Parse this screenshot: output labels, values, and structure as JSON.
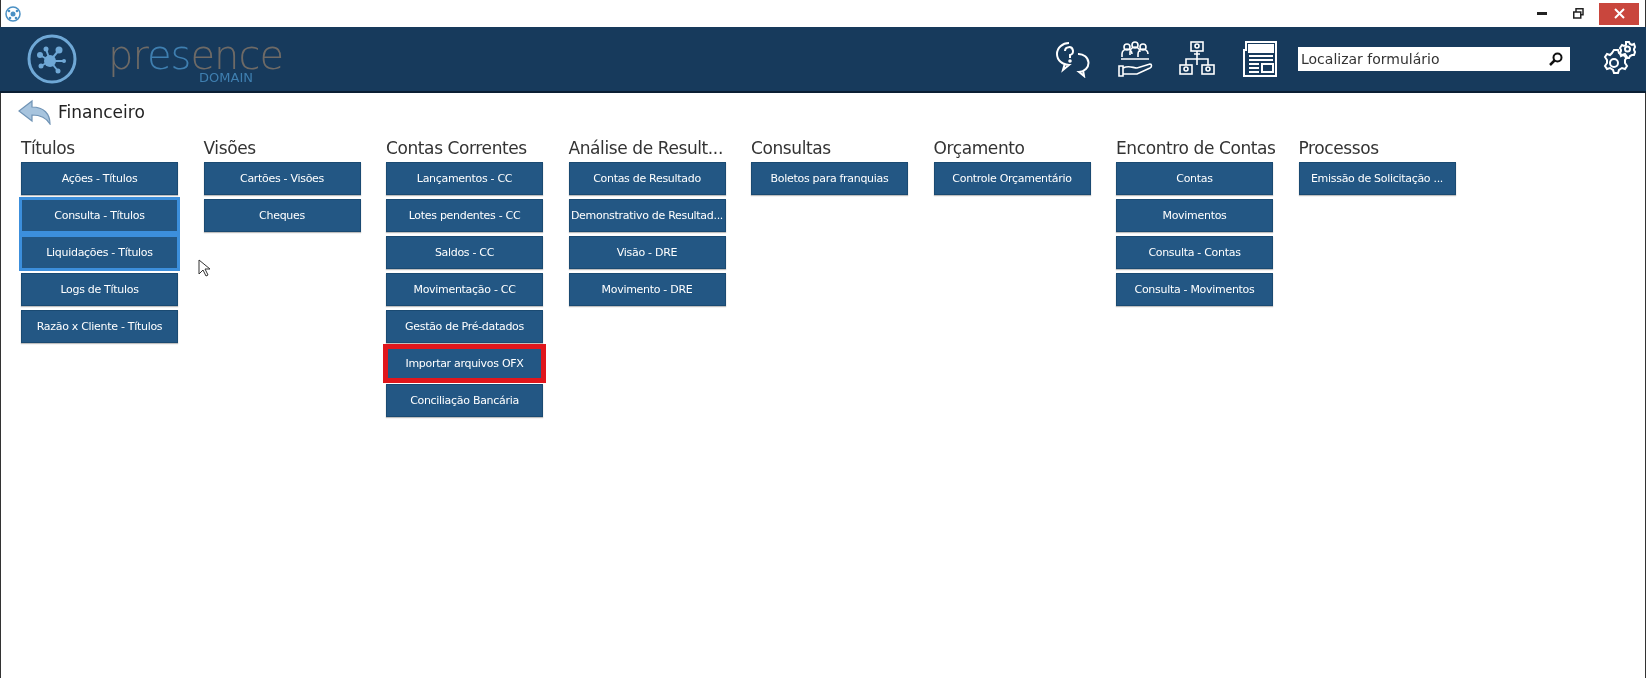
{
  "logo": {
    "word_parts": [
      {
        "text": "pr",
        "color": "#6e6a66"
      },
      {
        "text": "es",
        "color": "#3f7fb0"
      },
      {
        "text": "ence",
        "color": "#6e6a66"
      }
    ],
    "tagline": "DOMAIN"
  },
  "search": {
    "placeholder": "Localizar formulário"
  },
  "breadcrumb": {
    "title": "Financeiro"
  },
  "groups": [
    {
      "title": "Títulos",
      "items": [
        {
          "label": "Ações - Títulos",
          "focused": false,
          "annotated": false
        },
        {
          "label": "Consulta - Títulos",
          "focused": true,
          "annotated": false
        },
        {
          "label": "Liquidações - Títulos",
          "focused": true,
          "annotated": false
        },
        {
          "label": "Logs de Títulos",
          "focused": false,
          "annotated": false
        },
        {
          "label": "Razão x Cliente - Títulos",
          "focused": false,
          "annotated": false
        }
      ]
    },
    {
      "title": "Visões",
      "items": [
        {
          "label": "Cartões - Visões",
          "focused": false,
          "annotated": false
        },
        {
          "label": "Cheques",
          "focused": false,
          "annotated": false
        }
      ]
    },
    {
      "title": "Contas Correntes",
      "items": [
        {
          "label": "Lançamentos - CC",
          "focused": false,
          "annotated": false
        },
        {
          "label": "Lotes pendentes - CC",
          "focused": false,
          "annotated": false
        },
        {
          "label": "Saldos - CC",
          "focused": false,
          "annotated": false
        },
        {
          "label": "Movimentação - CC",
          "focused": false,
          "annotated": false
        },
        {
          "label": "Gestão de Pré-datados",
          "focused": false,
          "annotated": false
        },
        {
          "label": "Importar arquivos OFX",
          "focused": false,
          "annotated": true
        },
        {
          "label": "Conciliação Bancária",
          "focused": false,
          "annotated": false
        }
      ]
    },
    {
      "title": "Análise de Result...",
      "items": [
        {
          "label": "Contas de Resultado",
          "focused": false,
          "annotated": false
        },
        {
          "label": "Demonstrativo de Resultad...",
          "focused": false,
          "annotated": false
        },
        {
          "label": "Visão - DRE",
          "focused": false,
          "annotated": false
        },
        {
          "label": "Movimento - DRE",
          "focused": false,
          "annotated": false
        }
      ]
    },
    {
      "title": "Consultas",
      "items": [
        {
          "label": "Boletos para franquias",
          "focused": false,
          "annotated": false
        }
      ]
    },
    {
      "title": "Orçamento",
      "items": [
        {
          "label": "Controle Orçamentário",
          "focused": false,
          "annotated": false
        }
      ]
    },
    {
      "title": "Encontro de Contas",
      "items": [
        {
          "label": "Contas",
          "focused": false,
          "annotated": false
        },
        {
          "label": "Movimentos",
          "focused": false,
          "annotated": false
        },
        {
          "label": "Consulta - Contas",
          "focused": false,
          "annotated": false
        },
        {
          "label": "Consulta - Movimentos",
          "focused": false,
          "annotated": false
        }
      ]
    },
    {
      "title": "Processos",
      "items": [
        {
          "label": "Emissão de Solicitação ...",
          "focused": false,
          "annotated": false
        }
      ]
    }
  ]
}
